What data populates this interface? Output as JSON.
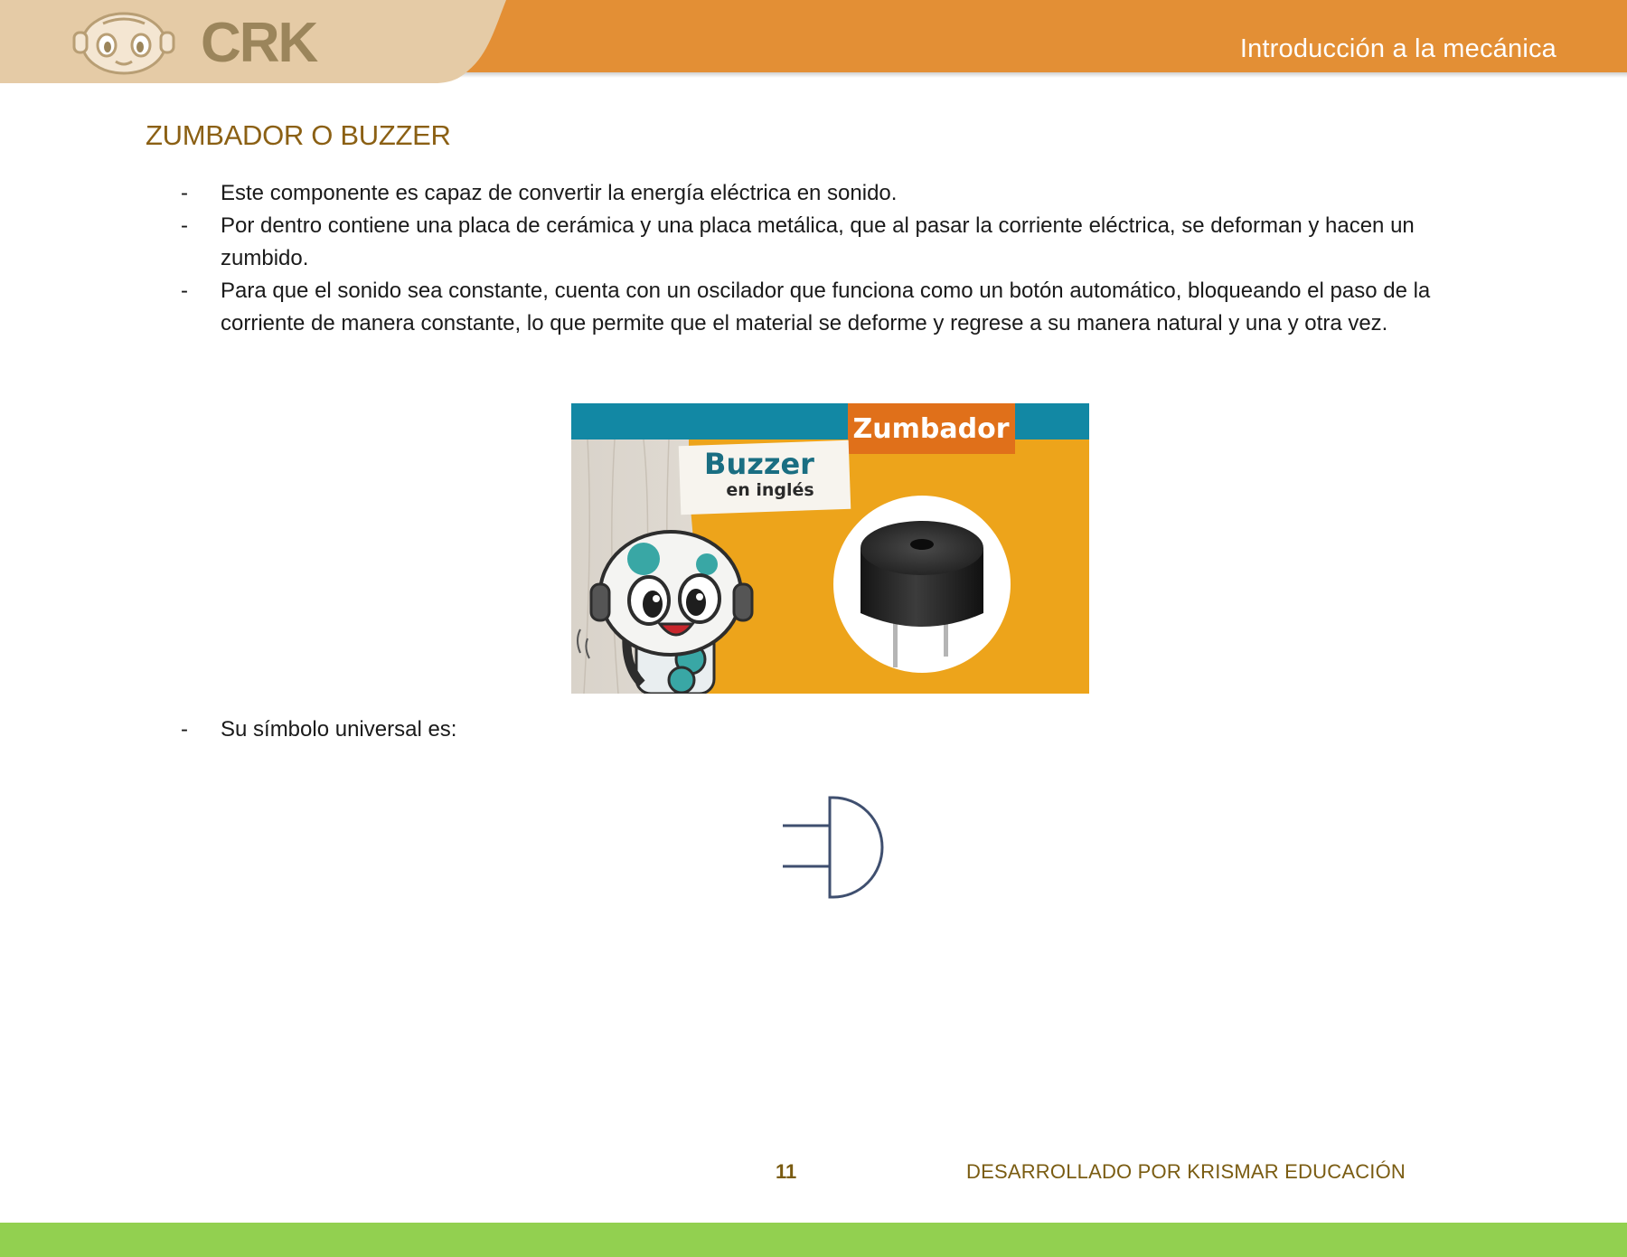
{
  "header": {
    "logo_text": "CRK",
    "title": "Introducción a la mecánica",
    "accent_color": "#e38f35",
    "logo_panel_color": "#e5cba6"
  },
  "section": {
    "title": "ZUMBADOR O BUZZER",
    "bullets": [
      {
        "dash": "-",
        "text": "Este componente es capaz de convertir la energía eléctrica en sonido."
      },
      {
        "dash": "-",
        "text": "Por dentro contiene una placa de cerámica y una placa metálica, que al pasar la corriente eléctrica, se deforman y hacen un zumbido."
      },
      {
        "dash": "-",
        "text": "Para que el sonido sea constante, cuenta con un oscilador que funciona como un botón automático, bloqueando el paso de la corriente de manera constante, lo que permite que el material se deforme y regrese a su manera natural y una y otra vez."
      }
    ],
    "symbol_bullet": {
      "dash": "-",
      "text": "Su símbolo universal es:"
    }
  },
  "figure": {
    "badge_label": "Zumbador",
    "card_title": "Buzzer",
    "card_subtitle": "en inglés"
  },
  "footer": {
    "page_number": "11",
    "credit": "DESARROLLADO POR KRISMAR EDUCACIÓN",
    "bar_color": "#92d050"
  }
}
